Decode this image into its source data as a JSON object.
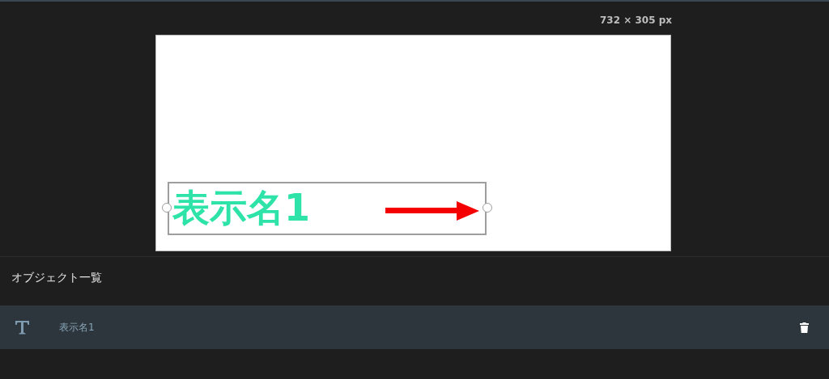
{
  "canvas": {
    "size_label": "732 × 305 px",
    "objects": [
      {
        "kind": "text",
        "text": "表示名1",
        "selected": true
      },
      {
        "kind": "arrow"
      }
    ]
  },
  "object_list": {
    "title": "オブジェクト一覧",
    "items": [
      {
        "kind": "text",
        "label": "表示名1",
        "selected": true
      }
    ]
  }
}
